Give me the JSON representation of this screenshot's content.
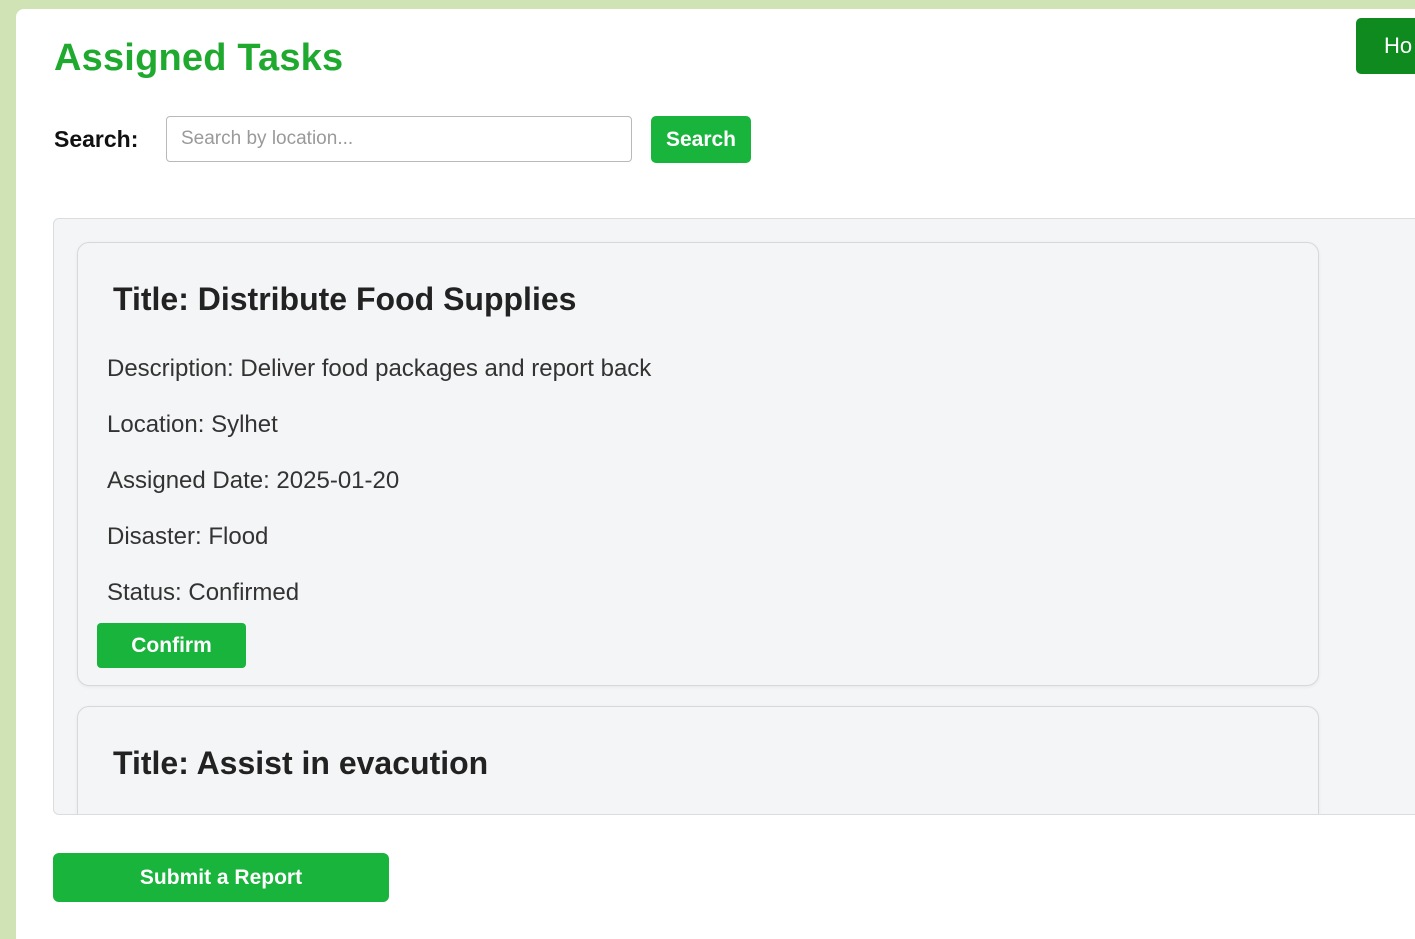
{
  "header": {
    "title": "Assigned Tasks",
    "home_label": "Ho"
  },
  "search": {
    "label": "Search:",
    "placeholder": "Search by location...",
    "value": "",
    "button_label": "Search"
  },
  "tasks": [
    {
      "title": "Title: Distribute Food Supplies",
      "description": "Description: Deliver food packages and report back",
      "location": "Location: Sylhet",
      "assigned_date": "Assigned Date: 2025-01-20",
      "disaster": "Disaster: Flood",
      "status": "Status: Confirmed",
      "confirm_label": "Confirm"
    },
    {
      "title": "Title: Assist in evacution"
    }
  ],
  "footer": {
    "submit_report_label": "Submit a Report"
  },
  "colors": {
    "accent_green": "#18b43c",
    "title_green": "#1faa2f",
    "home_green": "#0f8a1f",
    "backdrop": "#cfe3b4"
  }
}
